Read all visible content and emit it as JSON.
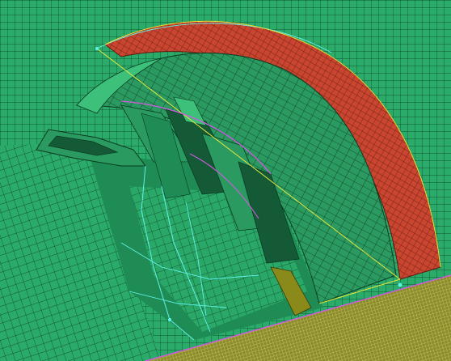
{
  "viewport": {
    "colors": {
      "background": "#0d0d0d",
      "mesh_fill": "#2bab6a",
      "mesh_fill_dark": "#1f8c55",
      "mesh_line": "#0a3a22",
      "blade_fill": "#2a9a60",
      "blade_dark": "#155a36",
      "shroud_fill": "#c9452f",
      "shroud_line": "#5a1a10",
      "floor_fill": "#8c8c2e",
      "floor_line": "#e0e06a",
      "edge_cyan": "#5ff2e8",
      "edge_yellow": "#e6e63c",
      "edge_magenta": "#d05adf",
      "olive": "#8a8a1a"
    },
    "objects": [
      "background-mesh-panel",
      "inner-hub-surface",
      "shroud-band",
      "impeller-blades",
      "inflow-duct",
      "floor-plane",
      "feature-edges"
    ]
  }
}
